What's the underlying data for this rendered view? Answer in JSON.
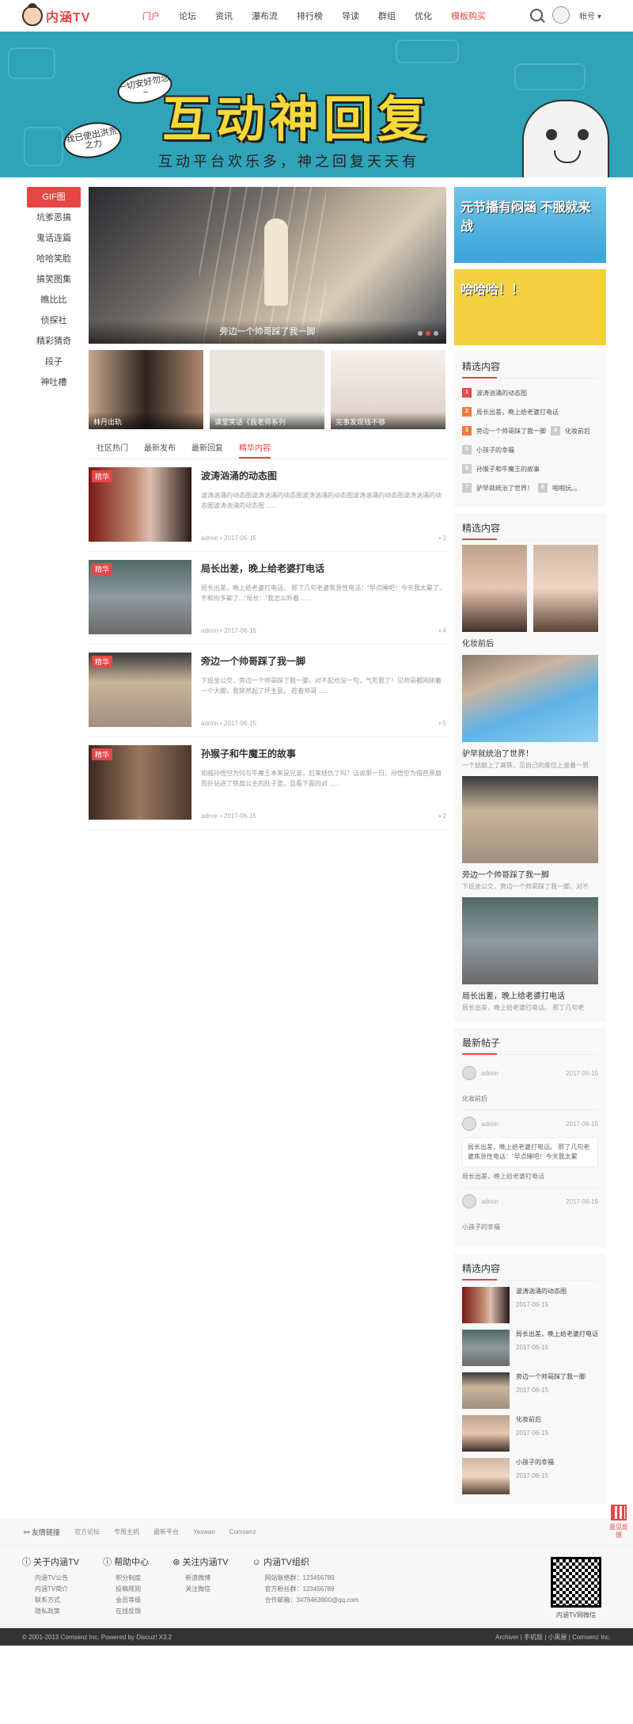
{
  "header": {
    "logo_text": "内涵TV",
    "nav": [
      "门户",
      "论坛",
      "资讯",
      "瀑布流",
      "排行榜",
      "导读",
      "群组",
      "优化",
      "模板购买"
    ],
    "account": "帐号"
  },
  "banner": {
    "title": "互动神回复",
    "subtitle": "互动平台欢乐多，神之回复天天有",
    "bubble1": "一切安好勿念~",
    "bubble2": "我已使出洪荒之力"
  },
  "sidebar": {
    "items": [
      "GIF图",
      "坑爹恶搞",
      "鬼话连篇",
      "哈哈笑脸",
      "搞笑图集",
      "瞧比比",
      "侦探社",
      "精彩猜奇",
      "段子",
      "神吐槽"
    ]
  },
  "slider": {
    "caption": "旁边一个帅哥踩了我一脚"
  },
  "thumbs": [
    "林丹出轨",
    "课堂笑话《我老师系列",
    "完事发现钱不够"
  ],
  "tabs": [
    "社区热门",
    "最新发布",
    "最新回复",
    "精华内容"
  ],
  "posts": [
    {
      "tag": "精华",
      "title": "波涛汹涌的动态图",
      "desc": "波涛汹涌的动态图波涛汹涌的动态图波涛汹涌的动态图波涛汹涌的动态图波涛汹涌的动态图波涛汹涌的动态图 ......",
      "author": "admin",
      "date": "2017-06-15",
      "count": "3"
    },
    {
      "tag": "精华",
      "title": "局长出差，晚上给老婆打电话",
      "desc": "局长出差，晚上给老婆打电话。 那了几句老婆焦急性电话：“早点睡吧！今天我太累了，不和你多聊了...”局长：“我怎么听着 ......",
      "author": "admin",
      "date": "2017-06-15",
      "count": "4"
    },
    {
      "tag": "精华",
      "title": "旁边一个帅哥踩了我一脚",
      "desc": "下班坐公交，旁边一个帅哥踩了我一脚，对不起也没一句，气死我了！见帅哥都刚刚着一个大脚，我突然起了坏主意。 趁着帅哥 ......",
      "author": "admin",
      "date": "2017-06-15",
      "count": "5"
    },
    {
      "tag": "精华",
      "title": "孙猴子和牛魔王的故事",
      "desc": "如越孙悟空为何与牛魔王本来是兄弟，后来结仇了吗？话说那一日，孙悟空为借芭蕉扇而扑钻进了铁扇公主的肚子里，且看下面的对 ......",
      "author": "admin",
      "date": "2017-06-15",
      "count": "2"
    }
  ],
  "right": {
    "ad1": "元节播有闷涵 不服就来战",
    "ad2": "哈哈哈！！",
    "featured_title": "精选内容",
    "ranks": [
      {
        "n": "1",
        "t": "波涛汹涌的动态图"
      },
      {
        "n": "2",
        "t": "局长出差，晚上给老婆打电话"
      },
      {
        "n": "3",
        "t": "旁边一个帅哥踩了我一脚",
        "x": "化妆前后",
        "xn": "4"
      },
      {
        "n": "5",
        "t": "小孩子的幸福"
      },
      {
        "n": "6",
        "t": "孙猴子和牛魔王的故事"
      },
      {
        "n": "7",
        "t": "驴早就统治了世界！",
        "x": "啪啪玩。。",
        "xn": "8"
      }
    ],
    "pics_title": "精选内容",
    "pic_items": [
      {
        "t": "化妆前后",
        "d": ""
      },
      {
        "t": "驴早就统治了世界！",
        "d": "一个姑娘上了高铁，见自己的座位上坐着一男"
      },
      {
        "t": "旁边一个帅哥踩了我一脚",
        "d": "下班坐公交，旁边一个帅哥踩了我一脚，对不"
      },
      {
        "t": "局长出差，晚上给老婆打电话",
        "d": "局长出差，晚上给老婆打电话。 那了几句老"
      }
    ],
    "latest_title": "最新帖子",
    "latest": [
      {
        "u": "admin",
        "d": "2017-06-15",
        "t": "化妆前后",
        "q": ""
      },
      {
        "u": "admin",
        "d": "2017-06-15",
        "t": "局长出差，晚上给老婆打电话",
        "q": "局长出差，晚上给老婆打电话。 那了几句老婆焦急性电话：“早点睡吧！今天我太累"
      },
      {
        "u": "admin",
        "d": "2017-06-15",
        "t": "小孩子的幸福",
        "q": ""
      }
    ],
    "list_title": "精选内容",
    "list": [
      {
        "t": "波涛汹涌的动态图",
        "d": "2017-06-15"
      },
      {
        "t": "局长出差，晚上给老婆打电话",
        "d": "2017-06-15"
      },
      {
        "t": "旁边一个帅哥踩了我一脚",
        "d": "2017-06-15"
      },
      {
        "t": "化妆前后",
        "d": "2017-06-15"
      },
      {
        "t": "小孩子的幸福",
        "d": "2017-06-15"
      }
    ]
  },
  "float": {
    "label": "意见反馈"
  },
  "friend_links": {
    "label": "友情链接",
    "links": [
      "官方论坛",
      "专用主机",
      "最新平台",
      "Yeswan",
      "Comsenz"
    ]
  },
  "footer": {
    "cols": [
      {
        "h": "关于内涵TV",
        "items": [
          "内涵TV公告",
          "内涵TV简介",
          "联系方式",
          "隐私政策"
        ]
      },
      {
        "h": "帮助中心",
        "items": [
          "积分制度",
          "投稿规则",
          "会员等级",
          "在线反馈"
        ]
      },
      {
        "h": "关注内涵TV",
        "items": [
          "新浪微博",
          "关注微信"
        ]
      },
      {
        "h": "内涵TV组织",
        "items": [
          "网站联络群：123456789",
          "官方粉丝群：123456789",
          "合作邮箱：3476463900@qq.com"
        ]
      }
    ],
    "qr_caption": "内涵TV网微信",
    "copyright": "© 2001-2013 Comsenz Inc.  Powered by Discuz! X3.2",
    "right_links": "Archiver | 手机版 | 小黑屋 | Comsenz Inc."
  }
}
